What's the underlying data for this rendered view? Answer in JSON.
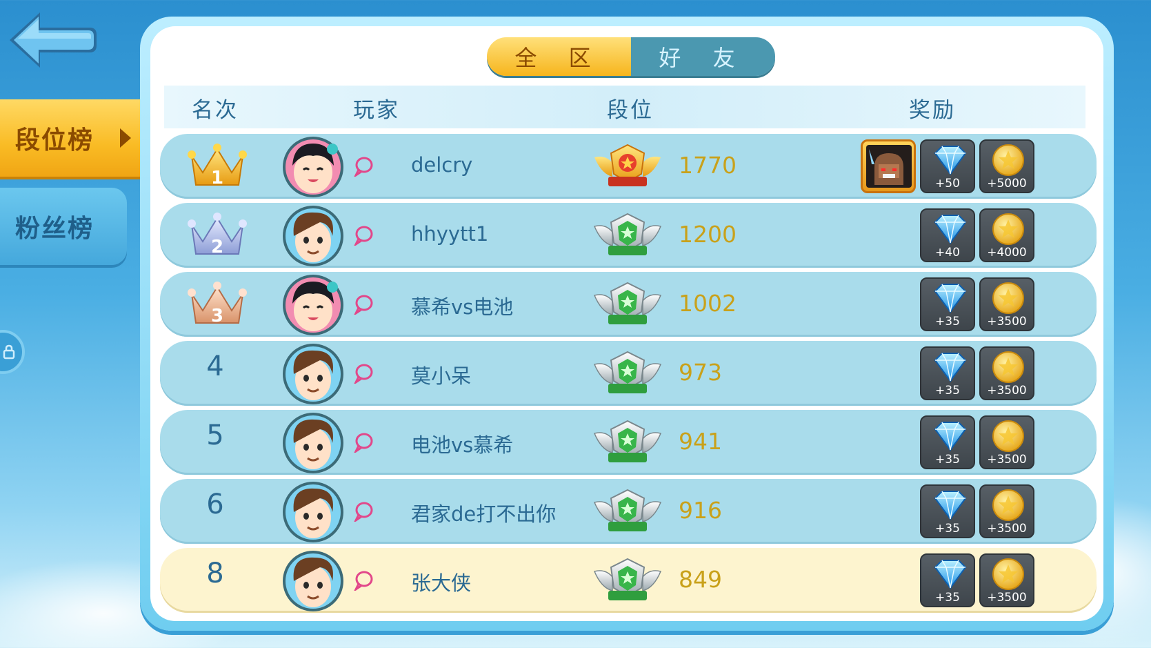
{
  "tabs": {
    "scope_all": "全 区",
    "scope_friends": "好 友",
    "side_rank": "段位榜",
    "side_fans": "粉丝榜"
  },
  "header": {
    "rank": "名次",
    "player": "玩家",
    "tier": "段位",
    "reward": "奖励"
  },
  "rows": [
    {
      "rank": "1",
      "name": "delcry",
      "score": "1770",
      "gem": "+50",
      "coin": "+5000"
    },
    {
      "rank": "2",
      "name": "hhyytt1",
      "score": "1200",
      "gem": "+40",
      "coin": "+4000"
    },
    {
      "rank": "3",
      "name": "慕希vs电池",
      "score": "1002",
      "gem": "+35",
      "coin": "+3500"
    },
    {
      "rank": "4",
      "name": "莫小呆",
      "score": "973",
      "gem": "+35",
      "coin": "+3500"
    },
    {
      "rank": "5",
      "name": "电池vs慕希",
      "score": "941",
      "gem": "+35",
      "coin": "+3500"
    },
    {
      "rank": "6",
      "name": "君家de打不出你",
      "score": "916",
      "gem": "+35",
      "coin": "+3500"
    },
    {
      "rank": "8",
      "name": "张大侠",
      "score": "849",
      "gem": "+35",
      "coin": "+3500"
    }
  ],
  "colors": {
    "accent_gold": "#f6b51d",
    "row_blue": "#a9dceb",
    "row_self": "#fdf4cf",
    "score_gold": "#c9a11a",
    "text_blue": "#2b6a93"
  },
  "icons": [
    "back-arrow-icon",
    "crown-gold-icon",
    "crown-silver-icon",
    "crown-bronze-icon",
    "avatar-girl-icon",
    "avatar-boy-icon",
    "chat-bubble-icon",
    "tier-gold-badge-icon",
    "tier-green-badge-icon",
    "diamond-icon",
    "coin-icon",
    "hero-card-icon",
    "lock-icon"
  ]
}
